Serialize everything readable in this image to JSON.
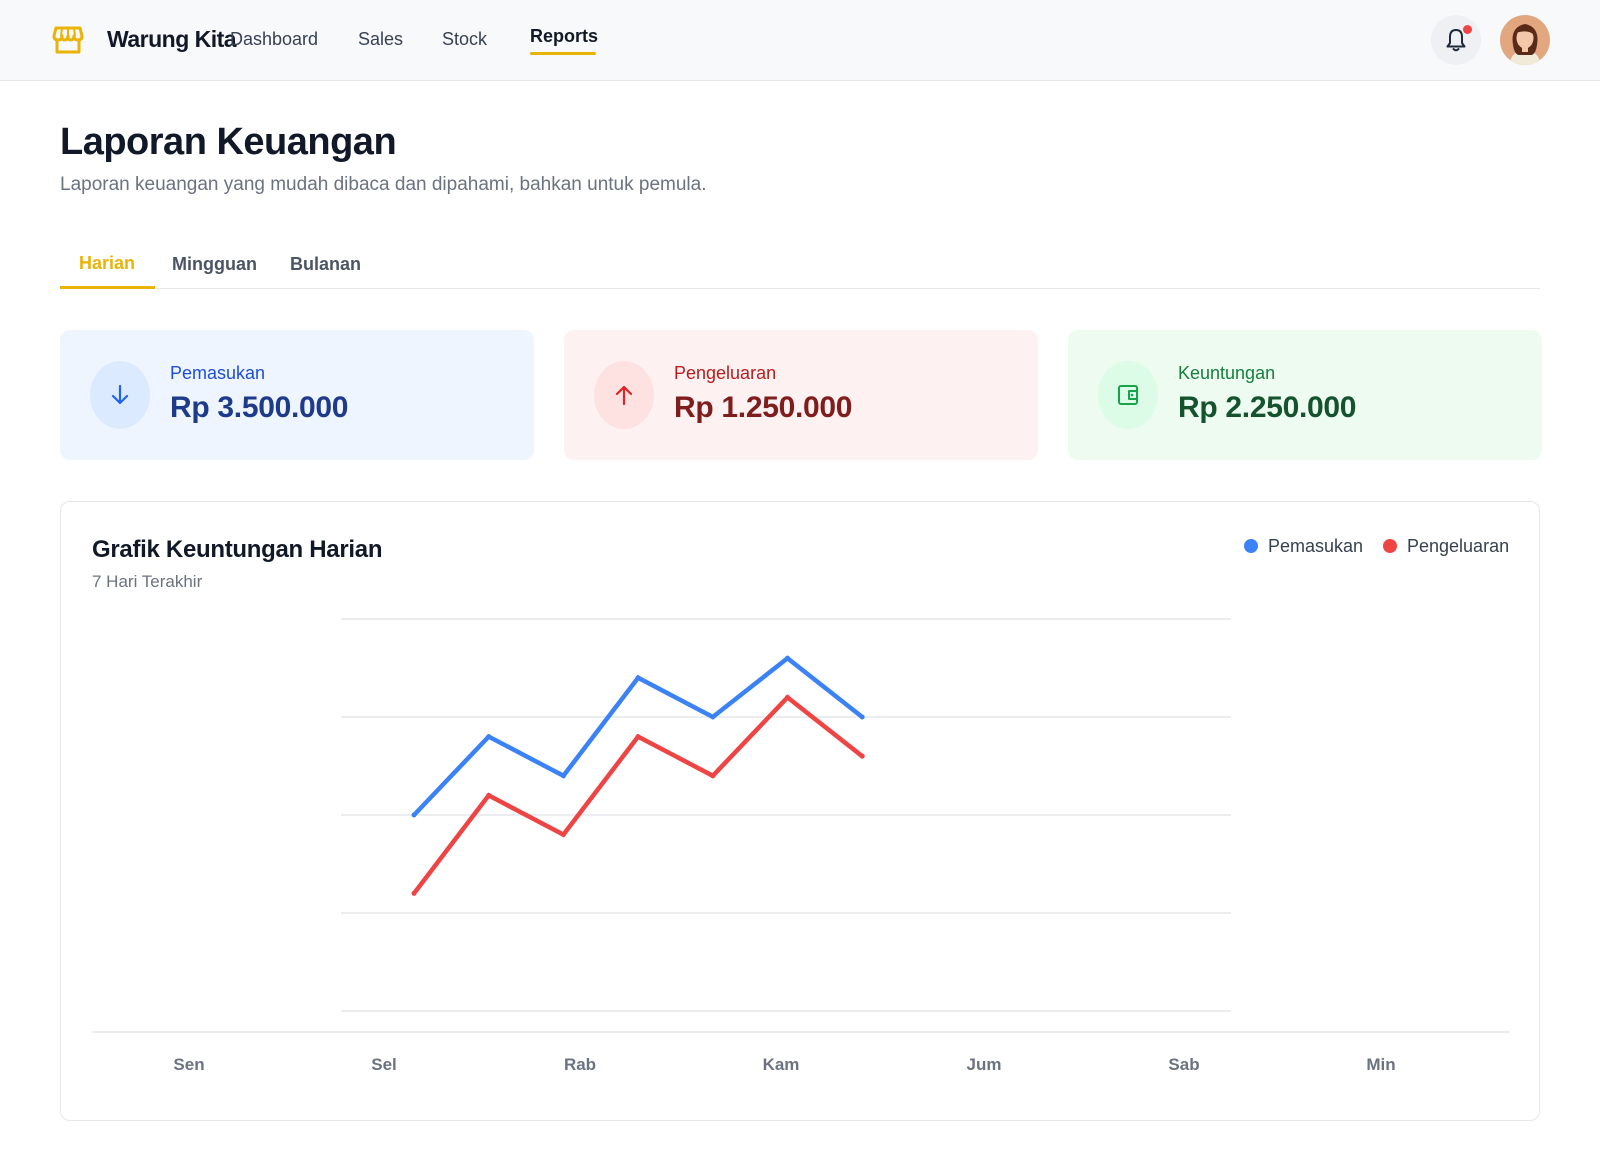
{
  "app": {
    "name": "Warung Kita",
    "brand_color": "#eab308"
  },
  "nav": {
    "items": [
      {
        "label": "Dashboard"
      },
      {
        "label": "Sales"
      },
      {
        "label": "Stock"
      },
      {
        "label": "Reports"
      }
    ],
    "active": "Reports"
  },
  "header_actions": {
    "notification_icon": "bell-icon",
    "has_unread": true,
    "avatar": "user-avatar"
  },
  "page": {
    "title": "Laporan Keuangan",
    "subtitle": "Laporan keuangan yang mudah dibaca dan dipahami, bahkan untuk pemula."
  },
  "tabs": {
    "items": [
      {
        "label": "Harian"
      },
      {
        "label": "Mingguan"
      },
      {
        "label": "Bulanan"
      }
    ],
    "active": "Harian"
  },
  "summary": {
    "income": {
      "label": "Pemasukan",
      "value": "Rp 3.500.000",
      "icon": "arrow-down-icon",
      "color": "#1e3a8a"
    },
    "expense": {
      "label": "Pengeluaran",
      "value": "Rp 1.250.000",
      "icon": "arrow-up-icon",
      "color": "#7f1d1d"
    },
    "profit": {
      "label": "Keuntungan",
      "value": "Rp 2.250.000",
      "icon": "wallet-icon",
      "color": "#14532d"
    }
  },
  "chart": {
    "title": "Grafik Keuntungan Harian",
    "subtitle": "7 Hari Terakhir"
  },
  "chart_data": {
    "type": "line",
    "title": "Grafik Keuntungan Harian",
    "subtitle": "7 Hari Terakhir",
    "categories": [
      "Sen",
      "Sel",
      "Rab",
      "Kam",
      "Jum",
      "Sab",
      "Min"
    ],
    "ylim": [
      0,
      4
    ],
    "grid": true,
    "legend_position": "top-right",
    "series": [
      {
        "name": "Pemasukan",
        "color": "#3b82f6",
        "values": [
          2,
          2.8,
          2.4,
          3.4,
          3,
          3.6,
          3
        ]
      },
      {
        "name": "Pengeluaran",
        "color": "#ef4444",
        "values": [
          1.2,
          2.2,
          1.8,
          2.8,
          2.4,
          3.2,
          2.6
        ]
      }
    ]
  }
}
